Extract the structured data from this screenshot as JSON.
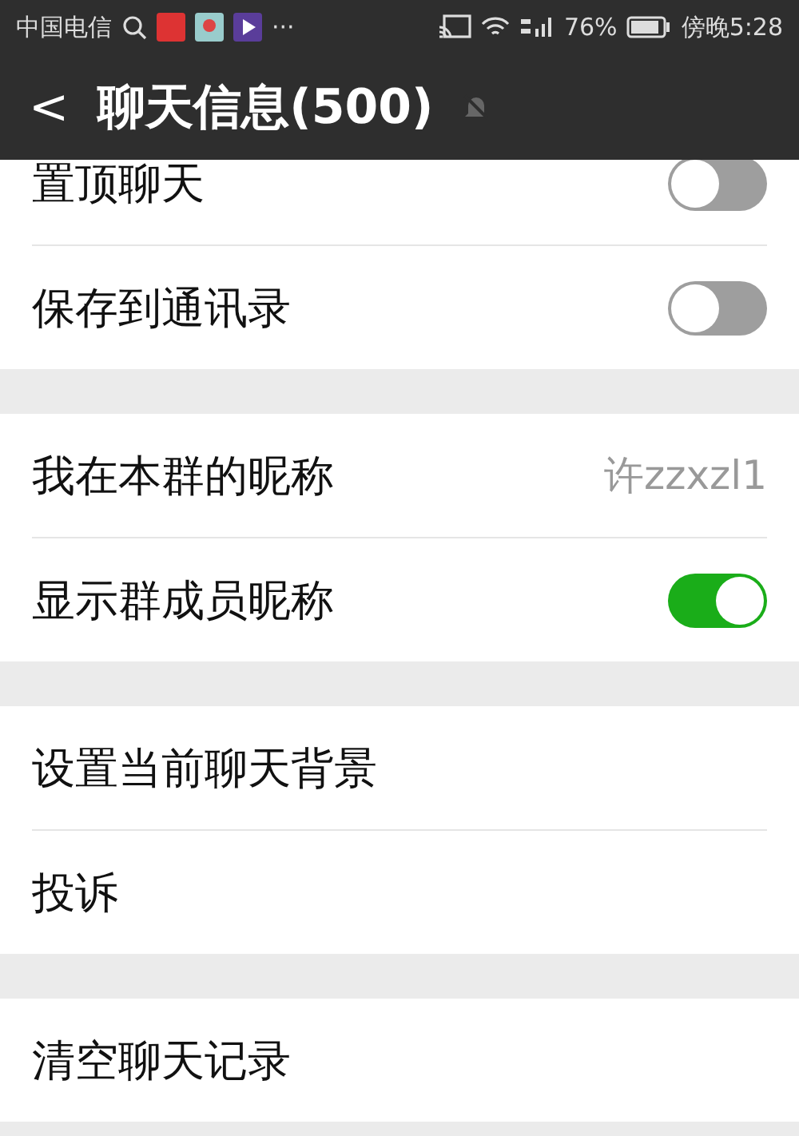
{
  "status_bar": {
    "carrier": "中国电信",
    "notification_more": "···",
    "battery": "76%",
    "time": "傍晚5:28"
  },
  "header": {
    "back": "<",
    "title": "聊天信息(500)",
    "muted": true
  },
  "groups": [
    {
      "items": [
        {
          "kind": "toggle",
          "label": "置顶聊天",
          "on": false
        },
        {
          "kind": "toggle",
          "label": "保存到通讯录",
          "on": false
        }
      ]
    },
    {
      "items": [
        {
          "kind": "value",
          "label": "我在本群的昵称",
          "value": "许zzxzl1"
        },
        {
          "kind": "toggle",
          "label": "显示群成员昵称",
          "on": true
        }
      ]
    },
    {
      "items": [
        {
          "kind": "plain",
          "label": "设置当前聊天背景"
        },
        {
          "kind": "plain",
          "label": "投诉"
        }
      ]
    },
    {
      "items": [
        {
          "kind": "plain",
          "label": "清空聊天记录"
        }
      ]
    }
  ]
}
